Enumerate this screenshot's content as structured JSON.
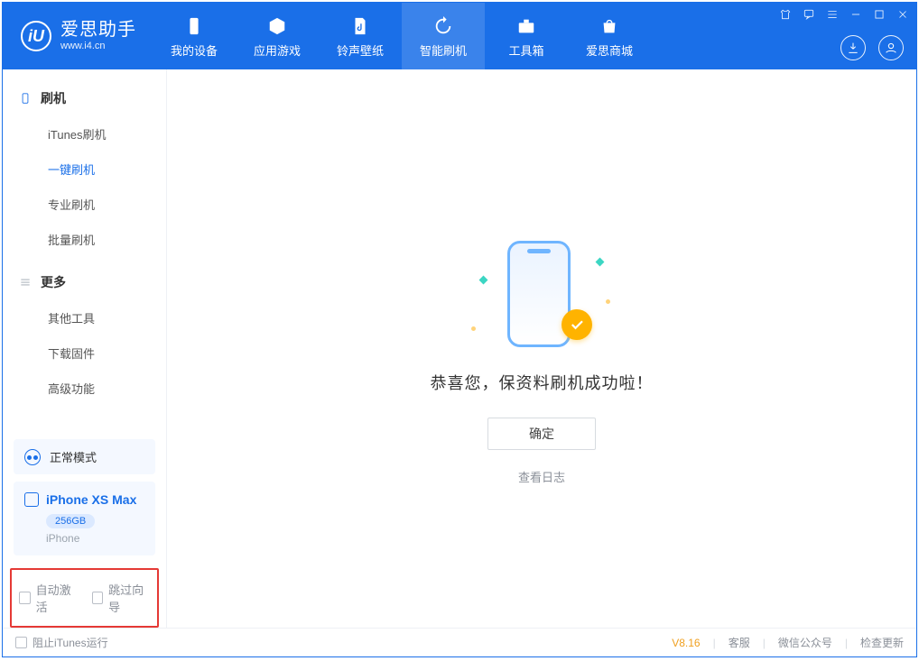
{
  "brand": {
    "title": "爱思助手",
    "subtitle": "www.i4.cn",
    "mark": "iU"
  },
  "nav": {
    "tabs": [
      {
        "key": "device",
        "label": "我的设备"
      },
      {
        "key": "apps",
        "label": "应用游戏"
      },
      {
        "key": "media",
        "label": "铃声壁纸"
      },
      {
        "key": "flash",
        "label": "智能刷机"
      },
      {
        "key": "tools",
        "label": "工具箱"
      },
      {
        "key": "store",
        "label": "爱思商城"
      }
    ],
    "active": "flash"
  },
  "sidebar": {
    "groups": [
      {
        "title": "刷机",
        "icon": "phone-icon",
        "items": [
          {
            "key": "itunes",
            "label": "iTunes刷机"
          },
          {
            "key": "oneclick",
            "label": "一键刷机",
            "active": true
          },
          {
            "key": "pro",
            "label": "专业刷机"
          },
          {
            "key": "batch",
            "label": "批量刷机"
          }
        ]
      },
      {
        "title": "更多",
        "icon": "menu-icon",
        "items": [
          {
            "key": "other",
            "label": "其他工具"
          },
          {
            "key": "firmware",
            "label": "下载固件"
          },
          {
            "key": "advanced",
            "label": "高级功能"
          }
        ]
      }
    ]
  },
  "device": {
    "mode": "正常模式",
    "name": "iPhone XS Max",
    "capacity": "256GB",
    "type": "iPhone"
  },
  "options": {
    "auto_activate": "自动激活",
    "skip_guide": "跳过向导"
  },
  "main": {
    "success_text": "恭喜您，保资料刷机成功啦！",
    "ok_label": "确定",
    "view_log": "查看日志"
  },
  "statusbar": {
    "block_itunes": "阻止iTunes运行",
    "version": "V8.16",
    "links": [
      "客服",
      "微信公众号",
      "检查更新"
    ]
  }
}
